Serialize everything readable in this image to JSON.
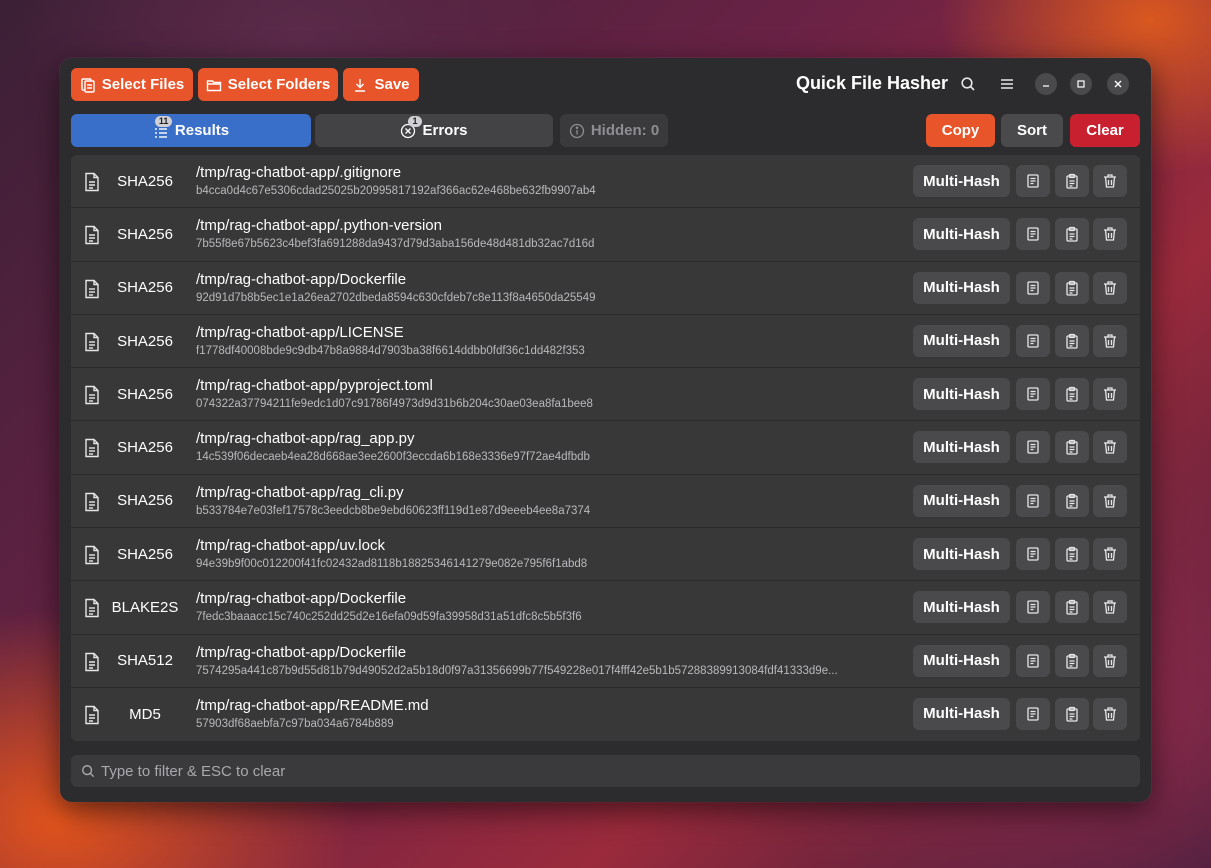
{
  "window": {
    "title": "Quick File Hasher"
  },
  "toolbar": {
    "select_files_label": "Select Files",
    "select_folders_label": "Select Folders",
    "save_label": "Save"
  },
  "tabs": {
    "results": {
      "label": "Results",
      "count": "11"
    },
    "errors": {
      "label": "Errors",
      "count": "1"
    },
    "hidden": {
      "label": "Hidden: 0"
    }
  },
  "actions": {
    "copy_label": "Copy",
    "sort_label": "Sort",
    "clear_label": "Clear"
  },
  "rows": [
    {
      "algo": "SHA256",
      "path": "/tmp/rag-chatbot-app/.gitignore",
      "hash": "b4cca0d4c67e5306cdad25025b20995817192af366ac62e468be632fb9907ab4",
      "button": "Multi-Hash"
    },
    {
      "algo": "SHA256",
      "path": "/tmp/rag-chatbot-app/.python-version",
      "hash": "7b55f8e67b5623c4bef3fa691288da9437d79d3aba156de48d481db32ac7d16d",
      "button": "Multi-Hash"
    },
    {
      "algo": "SHA256",
      "path": "/tmp/rag-chatbot-app/Dockerfile",
      "hash": "92d91d7b8b5ec1e1a26ea2702dbeda8594c630cfdeb7c8e113f8a4650da25549",
      "button": "Multi-Hash"
    },
    {
      "algo": "SHA256",
      "path": "/tmp/rag-chatbot-app/LICENSE",
      "hash": "f1778df40008bde9c9db47b8a9884d7903ba38f6614ddbb0fdf36c1dd482f353",
      "button": "Multi-Hash"
    },
    {
      "algo": "SHA256",
      "path": "/tmp/rag-chatbot-app/pyproject.toml",
      "hash": "074322a37794211fe9edc1d07c91786f4973d9d31b6b204c30ae03ea8fa1bee8",
      "button": "Multi-Hash"
    },
    {
      "algo": "SHA256",
      "path": "/tmp/rag-chatbot-app/rag_app.py",
      "hash": "14c539f06decaeb4ea28d668ae3ee2600f3eccda6b168e3336e97f72ae4dfbdb",
      "button": "Multi-Hash"
    },
    {
      "algo": "SHA256",
      "path": "/tmp/rag-chatbot-app/rag_cli.py",
      "hash": "b533784e7e03fef17578c3eedcb8be9ebd60623ff119d1e87d9eeeb4ee8a7374",
      "button": "Multi-Hash"
    },
    {
      "algo": "SHA256",
      "path": "/tmp/rag-chatbot-app/uv.lock",
      "hash": "94e39b9f00c012200f41fc02432ad8118b18825346141279e082e795f6f1abd8",
      "button": "Multi-Hash"
    },
    {
      "algo": "BLAKE2S",
      "path": "/tmp/rag-chatbot-app/Dockerfile",
      "hash": "7fedc3baaacc15c740c252dd25d2e16efa09d59fa39958d31a51dfc8c5b5f3f6",
      "button": "Multi-Hash"
    },
    {
      "algo": "SHA512",
      "path": "/tmp/rag-chatbot-app/Dockerfile",
      "hash": "7574295a441c87b9d55d81b79d49052d2a5b18d0f97a31356699b77f549228e017f4fff42e5b1b57288389913084fdf41333d9e...",
      "button": "Multi-Hash"
    },
    {
      "algo": "MD5",
      "path": "/tmp/rag-chatbot-app/README.md",
      "hash": "57903df68aebfa7c97ba034a6784b889",
      "button": "Multi-Hash"
    }
  ],
  "search": {
    "placeholder": "Type to filter & ESC to clear"
  },
  "colors": {
    "accent_orange": "#e8552b",
    "tab_active_blue": "#3a6fc9",
    "clear_red": "#c8202f",
    "window_bg": "#2c2c2e"
  },
  "icons": {
    "select_files": "files-icon",
    "select_folders": "folder-icon",
    "save": "download-icon",
    "search": "search-icon",
    "menu": "hamburger-menu-icon",
    "minimize": "minimize-icon",
    "maximize": "maximize-icon",
    "close": "close-icon",
    "results": "list-icon",
    "errors": "error-x-icon",
    "hidden": "info-icon",
    "row_file": "file-text-icon",
    "row_copy": "copy-icon",
    "row_paste": "clipboard-icon",
    "row_delete": "trash-icon"
  }
}
